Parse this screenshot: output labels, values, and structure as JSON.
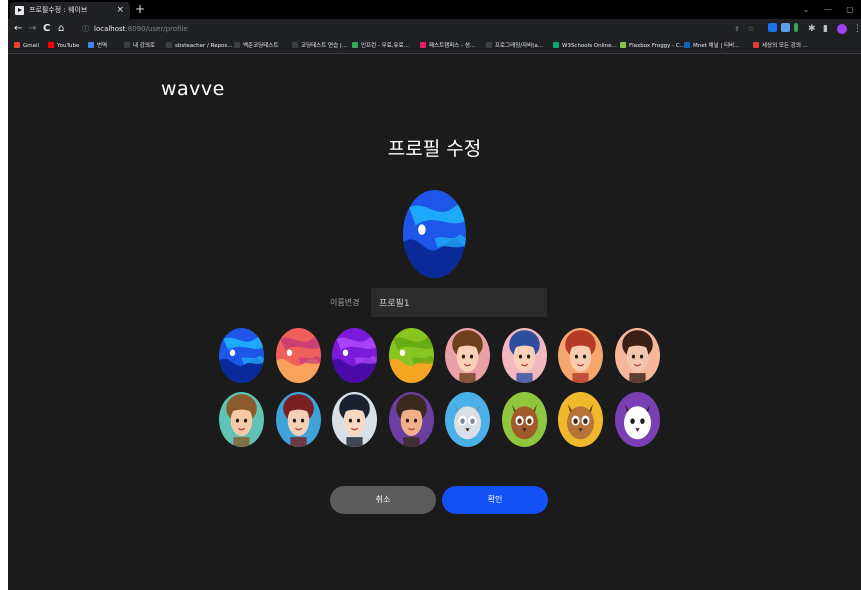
{
  "browser": {
    "tab_title": "프로필수정 : 웨이브",
    "tab_close": "×",
    "new_tab": "+",
    "url_host": "localhost",
    "url_path": ":8090/user/profile",
    "nav": {
      "back": "←",
      "forward": "→",
      "reload": "C",
      "home": "⌂"
    },
    "bookmarks": [
      {
        "label": "Gmail",
        "color": "#ea4335"
      },
      {
        "label": "YouTube",
        "color": "#ff0000"
      },
      {
        "label": "번역",
        "color": "#4285f4"
      },
      {
        "label": "내 강의로",
        "color": "#3c4043"
      },
      {
        "label": "sbsteacher / Repos...",
        "color": "#3c4043"
      },
      {
        "label": "백준코딩테스트",
        "color": "#3c4043"
      },
      {
        "label": "코딩테스트 연습 |...",
        "color": "#3c4043"
      },
      {
        "label": "인프런 - 무료,유료...",
        "color": "#34a853"
      },
      {
        "label": "패스트캠퍼스 - 성...",
        "color": "#e91e63"
      },
      {
        "label": "프로그래밍/자바(a...",
        "color": "#3c4043"
      },
      {
        "label": "W3Schools Online...",
        "color": "#04aa6d"
      },
      {
        "label": "Flexbox Froggy - C...",
        "color": "#8bc34a"
      },
      {
        "label": "Mnet 채널 | 티버...",
        "color": "#1565c0"
      },
      {
        "label": "세상의 모든 강의 ...",
        "color": "#e53935"
      }
    ]
  },
  "app": {
    "logo": "wavve",
    "title": "프로필 수정",
    "name_label": "이름변경",
    "name_value": "프로필1",
    "cancel_label": "취소",
    "confirm_label": "확인",
    "accent_color": "#1351f5"
  },
  "avatar_options": [
    {
      "name": "avatar-blue-planet",
      "kind": "planet",
      "c1": "#1e56e8",
      "c2": "#0a2a9a",
      "c3": "#1fb7ff"
    },
    {
      "name": "avatar-red-planet",
      "kind": "planet",
      "c1": "#f0605a",
      "c2": "#f9a25c",
      "c3": "#c43a7a"
    },
    {
      "name": "avatar-purple-planet",
      "kind": "planet",
      "c1": "#7b1ad8",
      "c2": "#4a0aa5",
      "c3": "#b24bff"
    },
    {
      "name": "avatar-green-planet",
      "kind": "planet",
      "c1": "#8ac421",
      "c2": "#f5a623",
      "c3": "#5ea813"
    },
    {
      "name": "avatar-girl-ponytail",
      "kind": "face",
      "bg": "#e9a0a6",
      "skin": "#f8d1b8",
      "hair": "#6d3f1f"
    },
    {
      "name": "avatar-girl-cap",
      "kind": "face",
      "bg": "#f2b8c0",
      "skin": "#f8d1b8",
      "hair": "#2d4f9e"
    },
    {
      "name": "avatar-girl-red-hair",
      "kind": "face",
      "bg": "#f6a76e",
      "skin": "#f6cdb0",
      "hair": "#b53a2a"
    },
    {
      "name": "avatar-girl-dark-hair",
      "kind": "face",
      "bg": "#f4b79a",
      "skin": "#f3c7ad",
      "hair": "#3a1f16"
    },
    {
      "name": "avatar-baby",
      "kind": "face",
      "bg": "#5fc4b6",
      "skin": "#f6c9a8",
      "hair": "#8a5a2b"
    },
    {
      "name": "avatar-boy-red-hair",
      "kind": "face",
      "bg": "#3fa2d8",
      "skin": "#f4cfb8",
      "hair": "#7a1f22"
    },
    {
      "name": "avatar-boy-black-hair",
      "kind": "face",
      "bg": "#d9dfe6",
      "skin": "#f6d8c4",
      "hair": "#1c2130"
    },
    {
      "name": "avatar-man-purple",
      "kind": "face",
      "bg": "#6a3fa0",
      "skin": "#efb08a",
      "hair": "#3a2a1d"
    },
    {
      "name": "avatar-cat",
      "kind": "animal",
      "bg": "#4ab0e8",
      "skin": "#d8dee6",
      "hair": "#7f8a99"
    },
    {
      "name": "avatar-bear",
      "kind": "animal",
      "bg": "#8ec63f",
      "skin": "#a15a2a",
      "hair": "#6b3612"
    },
    {
      "name": "avatar-owl",
      "kind": "animal",
      "bg": "#f0b92c",
      "skin": "#b7733a",
      "hair": "#4a2a12"
    },
    {
      "name": "avatar-panda",
      "kind": "animal",
      "bg": "#7a3fb3",
      "skin": "#ffffff",
      "hair": "#1d1d1d"
    }
  ]
}
